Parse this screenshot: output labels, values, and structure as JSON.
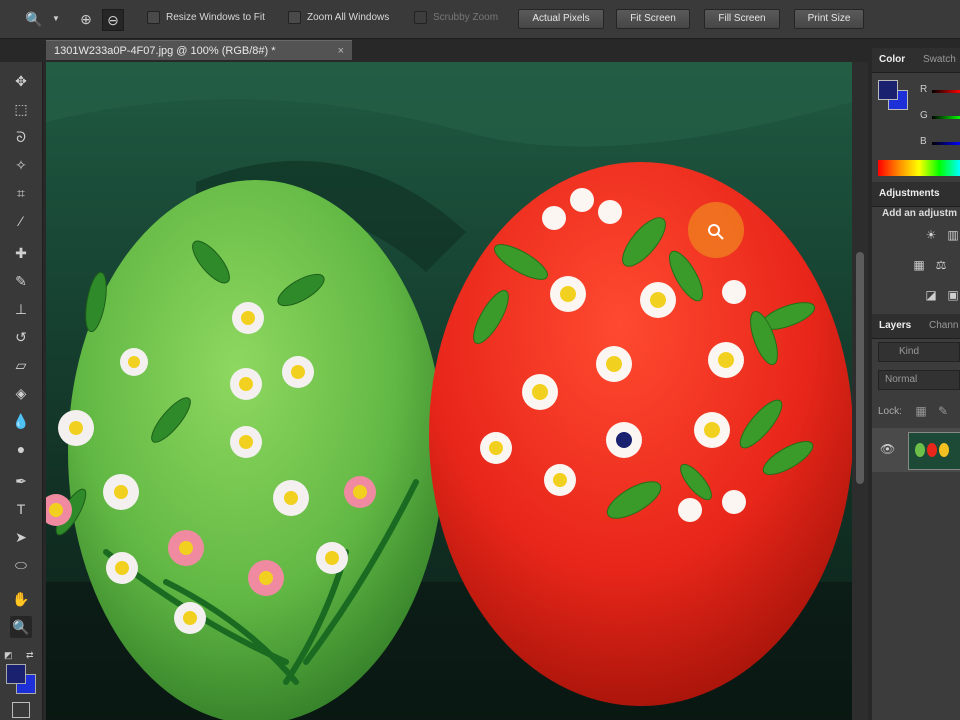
{
  "options_bar": {
    "resize_windows_label": "Resize Windows to Fit",
    "zoom_all_label": "Zoom All Windows",
    "scrubby_zoom_label": "Scrubby Zoom",
    "actual_pixels_label": "Actual Pixels",
    "fit_screen_label": "Fit Screen",
    "fill_screen_label": "Fill Screen",
    "print_size_label": "Print Size"
  },
  "document": {
    "tab_title": "1301W233a0P-4F07.jpg @ 100% (RGB/8#) *",
    "close_glyph": "×"
  },
  "panels": {
    "color_tab": "Color",
    "swatches_tab": "Swatch",
    "channel_r": "R",
    "channel_g": "G",
    "channel_b": "B",
    "adjustments_tab": "Adjustments",
    "add_adjustment": "Add an adjustm",
    "layers_tab": "Layers",
    "channels_tab": "Chann",
    "kind_label": "Kind",
    "blend_mode": "Normal",
    "lock_label": "Lock:"
  },
  "colors": {
    "foreground": "#1a2270",
    "background": "#1d2fd6",
    "red_egg": "#e8261a",
    "green_egg": "#6cc04a",
    "cloth": "#1c4a36"
  }
}
